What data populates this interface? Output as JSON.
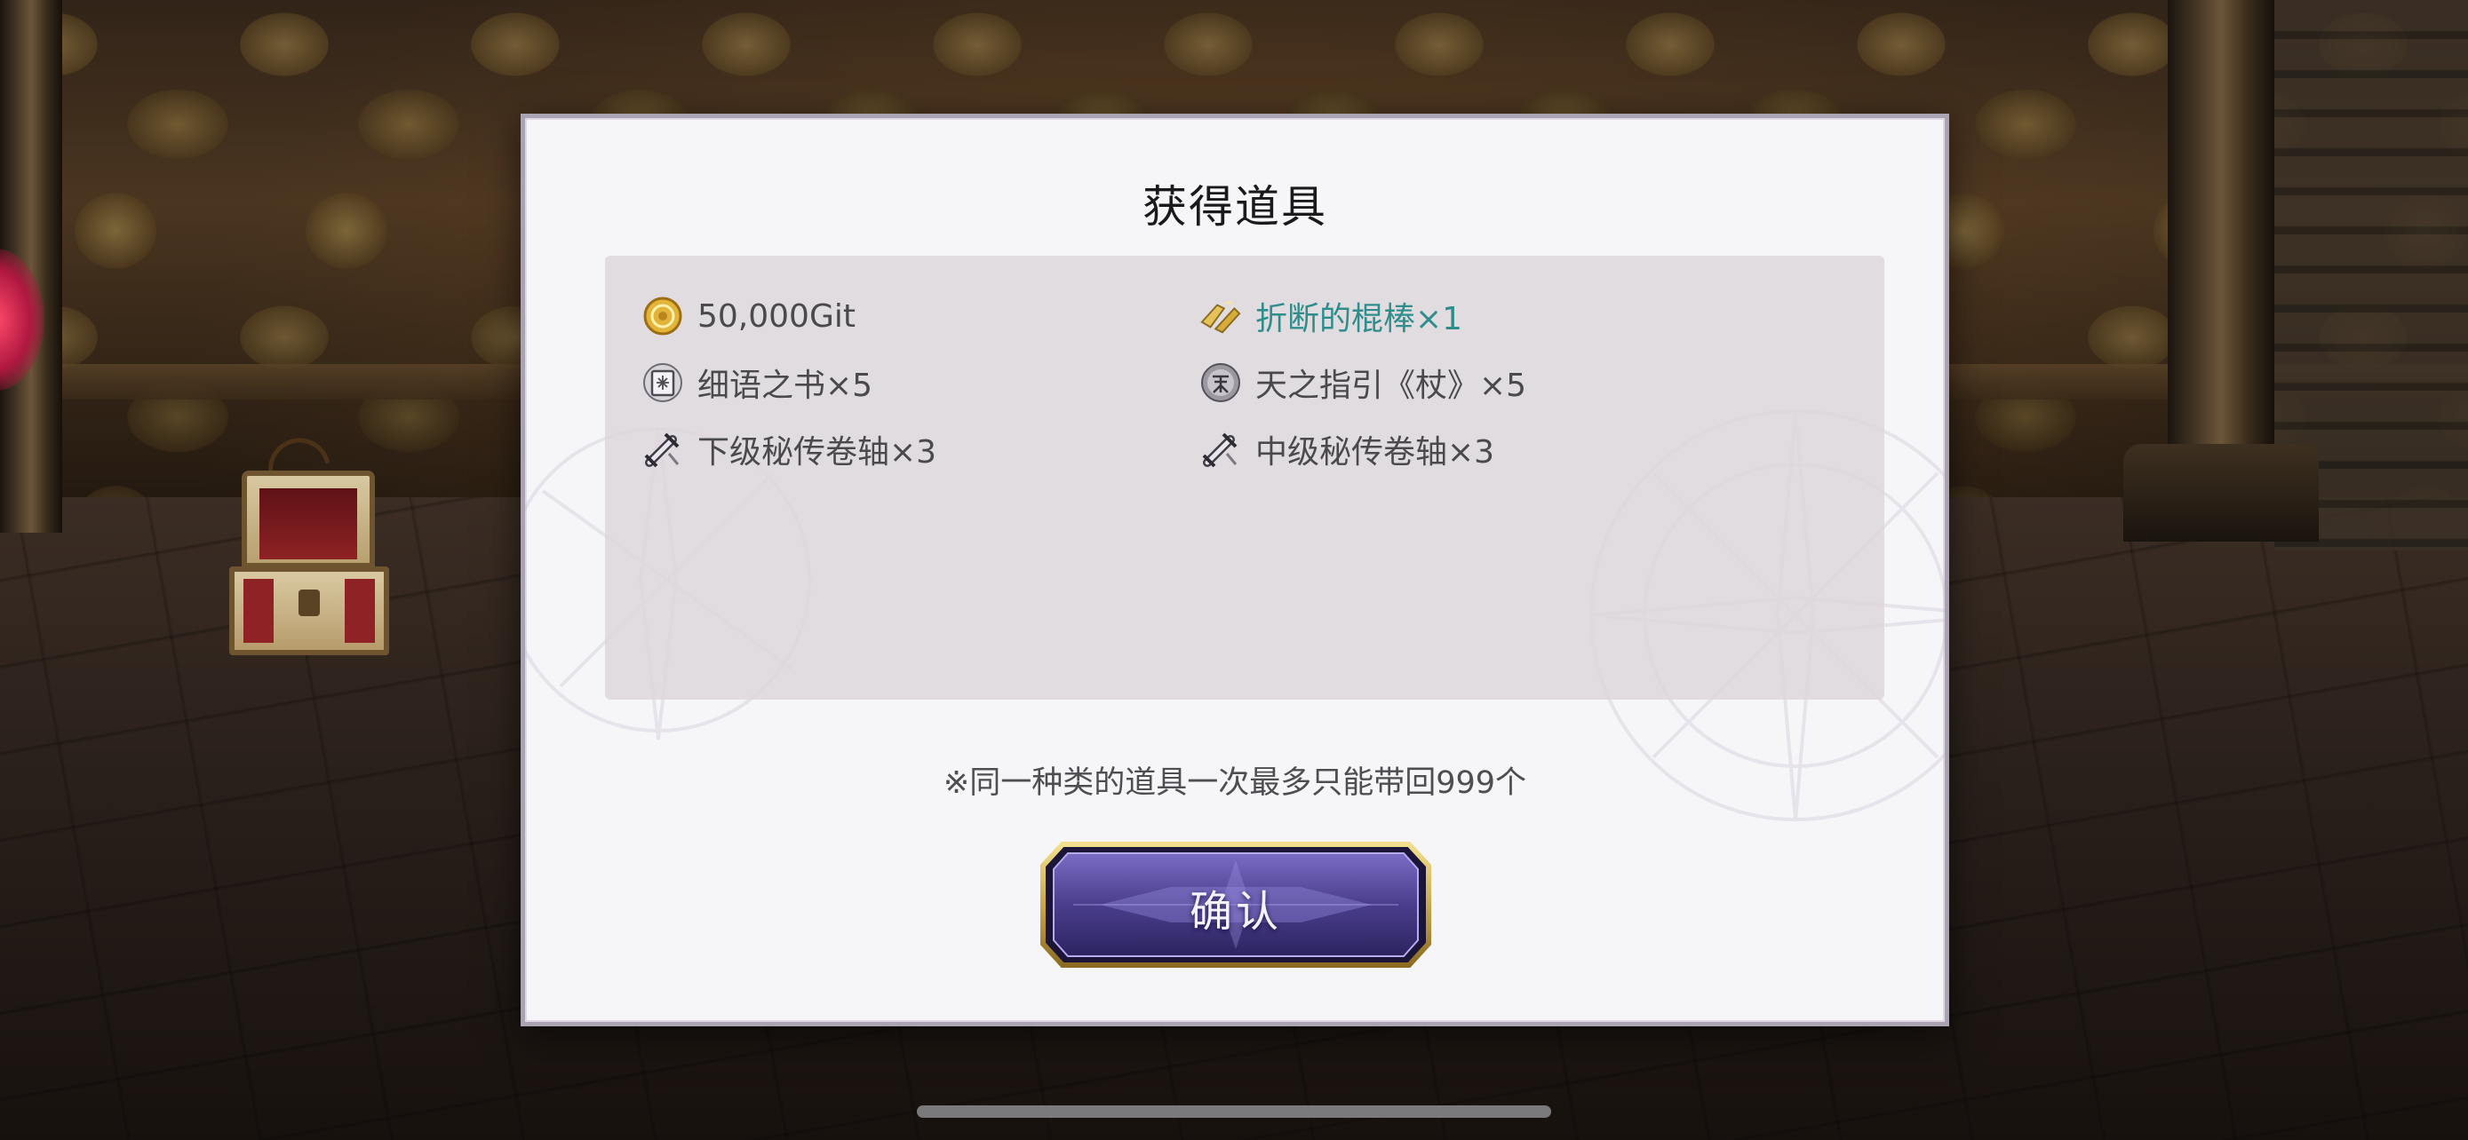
{
  "dialog": {
    "title": "获得道具",
    "items_left": [
      {
        "label": "50,000Git",
        "icon": "gold-coin-icon"
      },
      {
        "label": "细语之书×5",
        "icon": "book-icon"
      },
      {
        "label": "下级秘传卷轴×3",
        "icon": "scroll-icon"
      }
    ],
    "items_right": [
      {
        "label": "折断的棍棒×1",
        "icon": "broken-staff-icon",
        "highlight": true
      },
      {
        "label": "天之指引《杖》×5",
        "icon": "heaven-guide-icon"
      },
      {
        "label": "中级秘传卷轴×3",
        "icon": "scroll-icon"
      }
    ],
    "notice": "※同一种类的道具一次最多只能带回999个",
    "confirm_label": "确认"
  },
  "colors": {
    "highlight_text": "#2f8e8c",
    "normal_text": "#4a4a4e",
    "button_purple": "#4b3f8f",
    "button_gold": "#c9a94a"
  }
}
